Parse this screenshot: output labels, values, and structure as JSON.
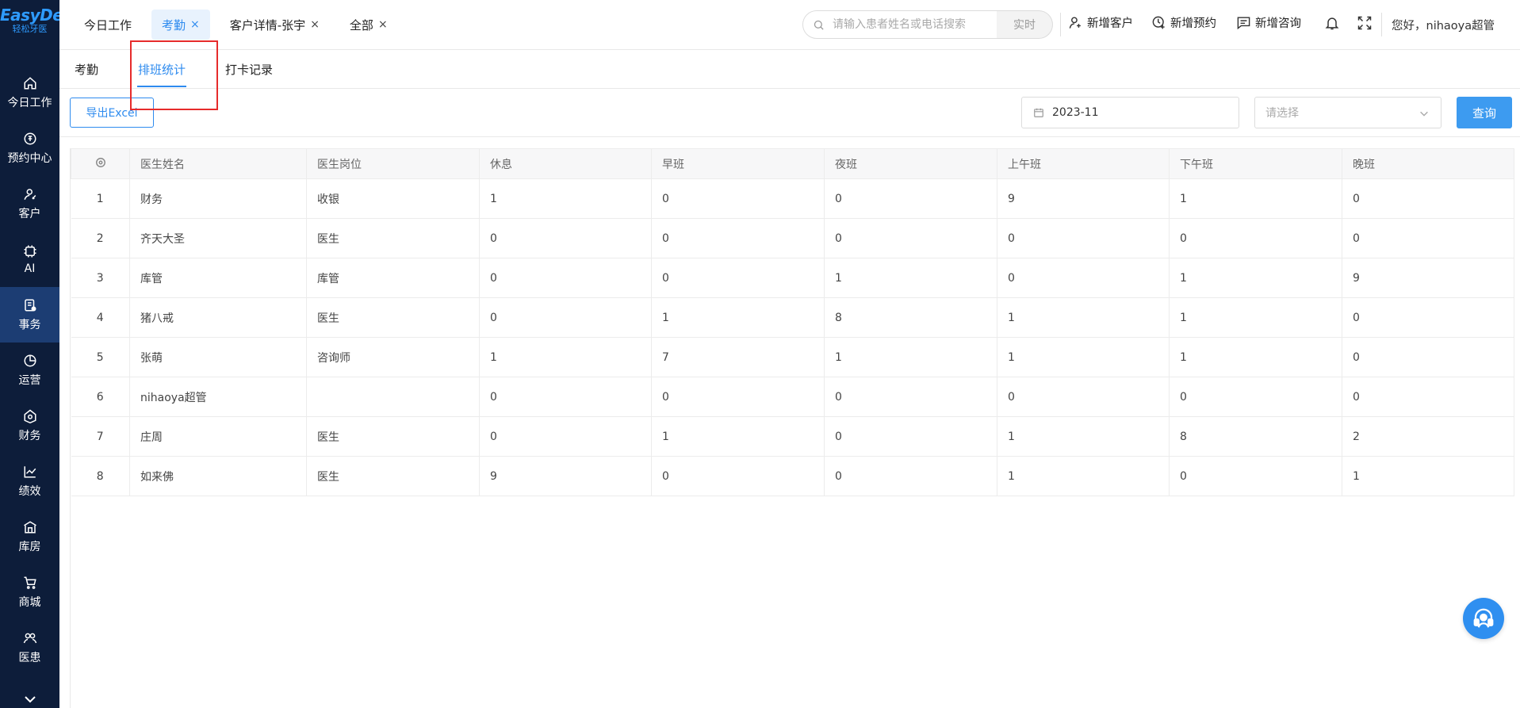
{
  "brand": {
    "name": "EasyDent",
    "sub": "轻松牙医"
  },
  "sidebar": {
    "items": [
      {
        "label": "今日工作",
        "icon": "home-icon"
      },
      {
        "label": "预约中心",
        "icon": "appointment-icon"
      },
      {
        "label": "客户",
        "icon": "customer-icon"
      },
      {
        "label": "AI",
        "icon": "ai-chip-icon"
      },
      {
        "label": "事务",
        "icon": "affairs-icon",
        "active": true
      },
      {
        "label": "运营",
        "icon": "pie-chart-icon"
      },
      {
        "label": "财务",
        "icon": "finance-icon"
      },
      {
        "label": "绩效",
        "icon": "trend-icon"
      },
      {
        "label": "库房",
        "icon": "warehouse-icon"
      },
      {
        "label": "商城",
        "icon": "cart-icon"
      },
      {
        "label": "医患",
        "icon": "doctor-patient-icon"
      }
    ]
  },
  "header": {
    "tabs": [
      {
        "label": "今日工作",
        "closable": false
      },
      {
        "label": "考勤",
        "closable": true,
        "active": true
      },
      {
        "label": "客户详情-张宇",
        "closable": true
      },
      {
        "label": "全部",
        "closable": true
      }
    ],
    "close_glyph": "×",
    "search_placeholder": "请输入患者姓名或电话搜索",
    "realtime_label": "实时",
    "actions": {
      "new_customer": "新增客户",
      "new_appointment": "新增预约",
      "new_consult": "新增咨询"
    },
    "user_greeting": "您好，nihaoya超管"
  },
  "subtabs": {
    "attendance": "考勤",
    "schedule_stats": "排班统计",
    "punch_records": "打卡记录"
  },
  "toolbar": {
    "export_label": "导出Excel",
    "month_value": "2023-11",
    "select_placeholder": "请选择",
    "query_label": "查询"
  },
  "table": {
    "headers": [
      "医生姓名",
      "医生岗位",
      "休息",
      "早班",
      "夜班",
      "上午班",
      "下午班",
      "晚班"
    ],
    "rows": [
      [
        "1",
        "财务",
        "收银",
        "1",
        "0",
        "0",
        "9",
        "1",
        "0"
      ],
      [
        "2",
        "齐天大圣",
        "医生",
        "0",
        "0",
        "0",
        "0",
        "0",
        "0"
      ],
      [
        "3",
        "库管",
        "库管",
        "0",
        "0",
        "1",
        "0",
        "1",
        "9"
      ],
      [
        "4",
        "猪八戒",
        "医生",
        "0",
        "1",
        "8",
        "1",
        "1",
        "0"
      ],
      [
        "5",
        "张萌",
        "咨询师",
        "1",
        "7",
        "1",
        "1",
        "1",
        "0"
      ],
      [
        "6",
        "nihaoya超管",
        "",
        "0",
        "0",
        "0",
        "0",
        "0",
        "0"
      ],
      [
        "7",
        "庄周",
        "医生",
        "0",
        "1",
        "0",
        "1",
        "8",
        "2"
      ],
      [
        "8",
        "如来佛",
        "医生",
        "9",
        "0",
        "0",
        "1",
        "0",
        "1"
      ]
    ]
  },
  "colors": {
    "sidebar_bg": "#0d1d3a",
    "sidebar_active": "#1c3d73",
    "accent": "#2e8bef",
    "highlight": "#e62b2b"
  }
}
